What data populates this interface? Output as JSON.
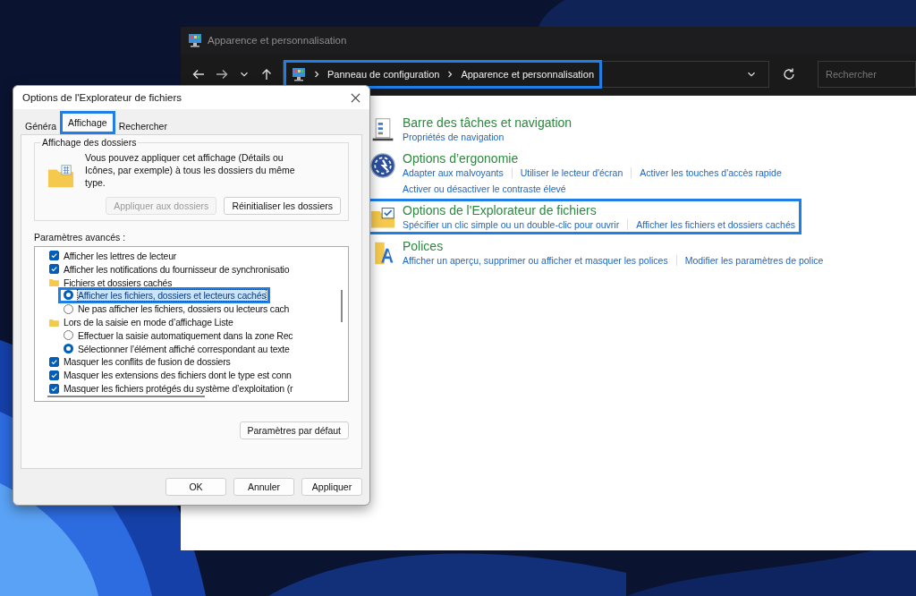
{
  "control_panel": {
    "title": "Apparence et personnalisation",
    "breadcrumb": {
      "highlighted": true,
      "items": [
        {
          "label": "Panneau de configuration"
        },
        {
          "label": "Apparence et personnalisation"
        }
      ]
    },
    "search": {
      "placeholder": "Rechercher"
    },
    "categories": [
      {
        "kind": "taskbar",
        "title": "Barre des tâches et navigation",
        "highlighted": false,
        "links": [
          "Propriétés de navigation"
        ]
      },
      {
        "kind": "ergonomics",
        "title": "Options d’ergonomie",
        "highlighted": false,
        "links": [
          "Adapter aux malvoyants",
          "Utiliser le lecteur d'écran",
          "Activer les touches d'accès rapide",
          "Activer ou désactiver le contraste élevé"
        ]
      },
      {
        "kind": "folder",
        "title": "Options de l'Explorateur de fichiers",
        "highlighted": true,
        "links": [
          "Spécifier un clic simple ou un double-clic pour ouvrir",
          "Afficher les fichiers et dossiers cachés"
        ]
      },
      {
        "kind": "fonts",
        "title": "Polices",
        "highlighted": false,
        "links": [
          "Afficher un aperçu, supprimer ou afficher et masquer les polices",
          "Modifier les paramètres de police"
        ]
      }
    ]
  },
  "dialog": {
    "title": "Options de l'Explorateur de fichiers",
    "tabs": [
      {
        "label": "Généra",
        "selected": false,
        "highlighted": false
      },
      {
        "label": "Affichage",
        "selected": true,
        "highlighted": true
      },
      {
        "label": "Rechercher",
        "selected": false,
        "highlighted": false
      }
    ],
    "folder_views": {
      "legend": "Affichage des dossiers",
      "text": "Vous pouvez appliquer cet affichage (Détails ou Icônes, par exemple) à tous les dossiers du même type.",
      "buttons": [
        {
          "label": "Appliquer aux dossiers",
          "disabled": true
        },
        {
          "label": "Réinitialiser les dossiers",
          "disabled": false
        }
      ]
    },
    "advanced": {
      "label": "Paramètres avancés :",
      "items": [
        {
          "kind": "checkbox",
          "label": "Afficher les lettres de lecteur",
          "checked": true
        },
        {
          "kind": "checkbox",
          "label": "Afficher les notifications du fournisseur de synchronisatio",
          "checked": true
        },
        {
          "kind": "folder",
          "label": "Fichiers et dossiers cachés",
          "children": [
            {
              "kind": "radio",
              "label": "Afficher les fichiers, dossiers et lecteurs cachés",
              "selected": true,
              "highlighted": true
            },
            {
              "kind": "radio",
              "label": "Ne pas afficher les fichiers, dossiers ou lecteurs cach",
              "selected": false,
              "highlighted": false
            }
          ]
        },
        {
          "kind": "folder",
          "label": "Lors de la saisie en mode d’affichage Liste",
          "children": [
            {
              "kind": "radio",
              "label": "Effectuer la saisie automatiquement dans la zone Rec",
              "selected": false,
              "highlighted": false
            },
            {
              "kind": "radio",
              "label": "Sélectionner l’élément affiché correspondant au texte",
              "selected": true,
              "highlighted": false
            }
          ]
        },
        {
          "kind": "checkbox",
          "label": "Masquer les conflits de fusion de dossiers",
          "checked": true
        },
        {
          "kind": "checkbox",
          "label": "Masquer les extensions des fichiers dont le type est conn",
          "checked": true
        },
        {
          "kind": "checkbox",
          "label": "Masquer les fichiers protégés du système d’exploitation (r",
          "checked": true
        }
      ]
    },
    "default_button": "Paramètres par défaut",
    "buttons": [
      {
        "label": "OK"
      },
      {
        "label": "Annuler"
      },
      {
        "label": "Appliquer"
      }
    ]
  }
}
